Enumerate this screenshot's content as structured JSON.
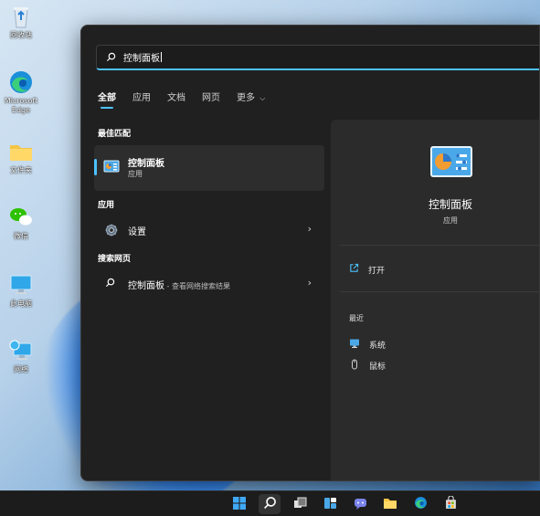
{
  "desktop": {
    "icons": [
      {
        "label": "回收站",
        "icon": "recycle-bin-icon"
      },
      {
        "label": "Microsoft Edge",
        "icon": "edge-icon"
      },
      {
        "label": "文件夹",
        "icon": "folder-icon"
      },
      {
        "label": "微信",
        "icon": "wechat-icon"
      },
      {
        "label": "此电脑",
        "icon": "computer-icon"
      },
      {
        "label": "网络",
        "icon": "network-icon"
      }
    ]
  },
  "search": {
    "query": "控制面板"
  },
  "tabs": [
    {
      "label": "全部",
      "active": true
    },
    {
      "label": "应用"
    },
    {
      "label": "文档"
    },
    {
      "label": "网页"
    },
    {
      "label": "更多"
    }
  ],
  "results": {
    "best_match_heading": "最佳匹配",
    "best_match": {
      "title": "控制面板",
      "subtitle": "应用",
      "icon": "control-panel-icon"
    },
    "apps_heading": "应用",
    "apps": [
      {
        "label": "设置",
        "icon": "settings-gear-icon"
      }
    ],
    "web_heading": "搜索网页",
    "web": [
      {
        "label": "控制面板",
        "suffix": " - 查看网络搜索结果",
        "icon": "search-icon"
      }
    ]
  },
  "preview": {
    "title": "控制面板",
    "subtitle": "应用",
    "open_label": "打开",
    "recent_heading": "最近",
    "recent": [
      {
        "label": "系统",
        "icon": "system-icon"
      },
      {
        "label": "鼠标",
        "icon": "mouse-icon"
      }
    ]
  },
  "taskbar": {
    "items": [
      "start-icon",
      "search-icon",
      "task-view-icon",
      "widgets-icon",
      "chat-icon",
      "file-explorer-icon",
      "edge-icon",
      "store-icon"
    ]
  },
  "colors": {
    "accent": "#4cc2ff",
    "panel_bg": "#202020",
    "card_bg": "#2b2b2b"
  }
}
